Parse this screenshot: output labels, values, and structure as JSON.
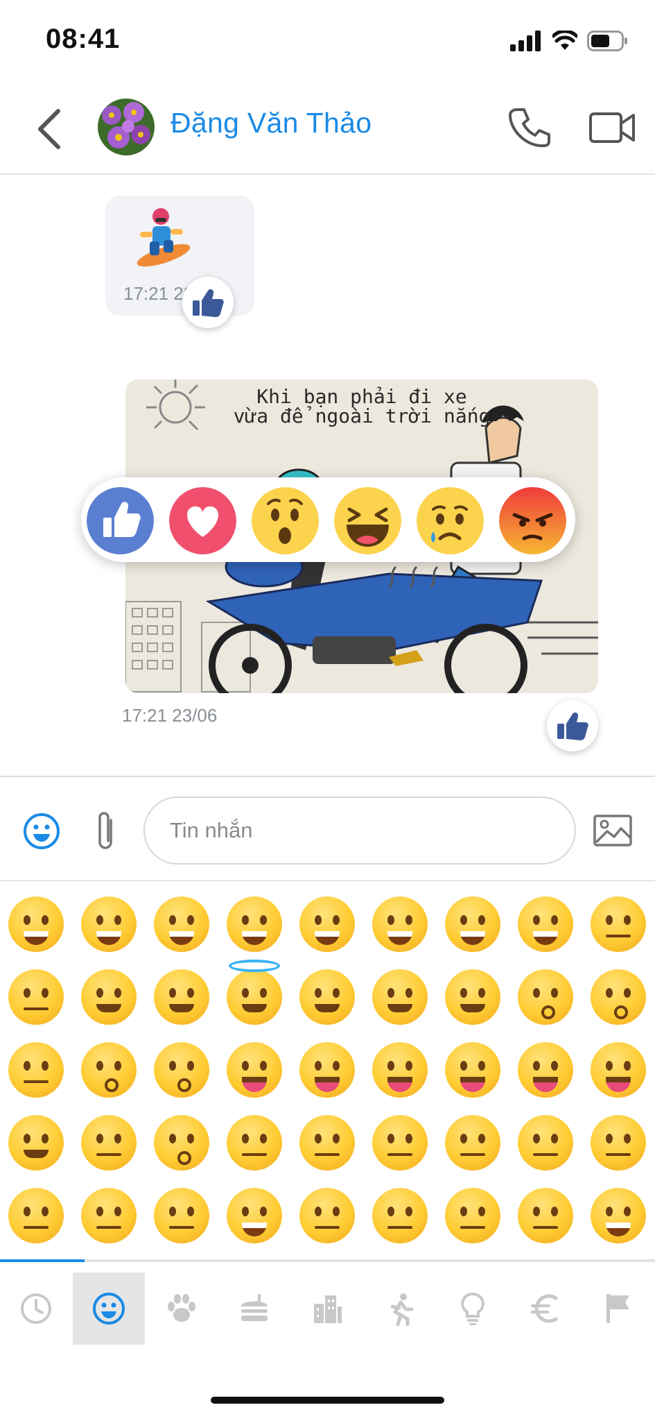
{
  "status_bar": {
    "time": "08:41"
  },
  "header": {
    "contact_name": "Đặng Văn Thảo"
  },
  "chat": {
    "messages": [
      {
        "type": "sticker",
        "timestamp": "17:21 23/06",
        "reaction": "like-icon"
      },
      {
        "type": "photo",
        "caption_line1": "Khi bạn phải đi xe",
        "caption_line2": "vừa để ngoài trời nắng",
        "timestamp": "17:21 23/06",
        "reaction": "like-icon"
      }
    ],
    "reactions": [
      "like",
      "love",
      "wow",
      "haha",
      "sad",
      "angry"
    ]
  },
  "composer": {
    "placeholder": "Tin nhắn"
  },
  "emoji_keyboard": {
    "rows": [
      [
        "grinning",
        "smiley",
        "smile",
        "grin",
        "laughing",
        "sweat-smile",
        "rofl",
        "joy",
        "slightly-smiling"
      ],
      [
        "upside-down",
        "wink",
        "blush",
        "innocent",
        "smiling-hearts",
        "heart-eyes",
        "star-struck",
        "kissing-heart",
        "kissing"
      ],
      [
        "relaxed",
        "kissing-closed-eyes",
        "kissing-smiling-eyes",
        "yum",
        "stuck-out-tongue",
        "stuck-out-tongue-wink",
        "zany",
        "stuck-out-tongue-closed-eyes",
        "money-mouth"
      ],
      [
        "hugging",
        "hand-over-mouth",
        "shushing",
        "thinking",
        "zipper-mouth",
        "raised-eyebrow",
        "neutral",
        "expressionless",
        "no-mouth"
      ],
      [
        "smirk",
        "unamused",
        "eye-roll",
        "grimacing",
        "lying",
        "relieved",
        "pensive",
        "sleepy",
        "drooling"
      ]
    ],
    "tabs": [
      "recent",
      "smileys",
      "animals",
      "food",
      "travel",
      "activity",
      "objects",
      "symbols",
      "flags"
    ],
    "active_tab": "smileys"
  },
  "colors": {
    "accent": "#1a8ae5",
    "like": "#3b5998"
  }
}
